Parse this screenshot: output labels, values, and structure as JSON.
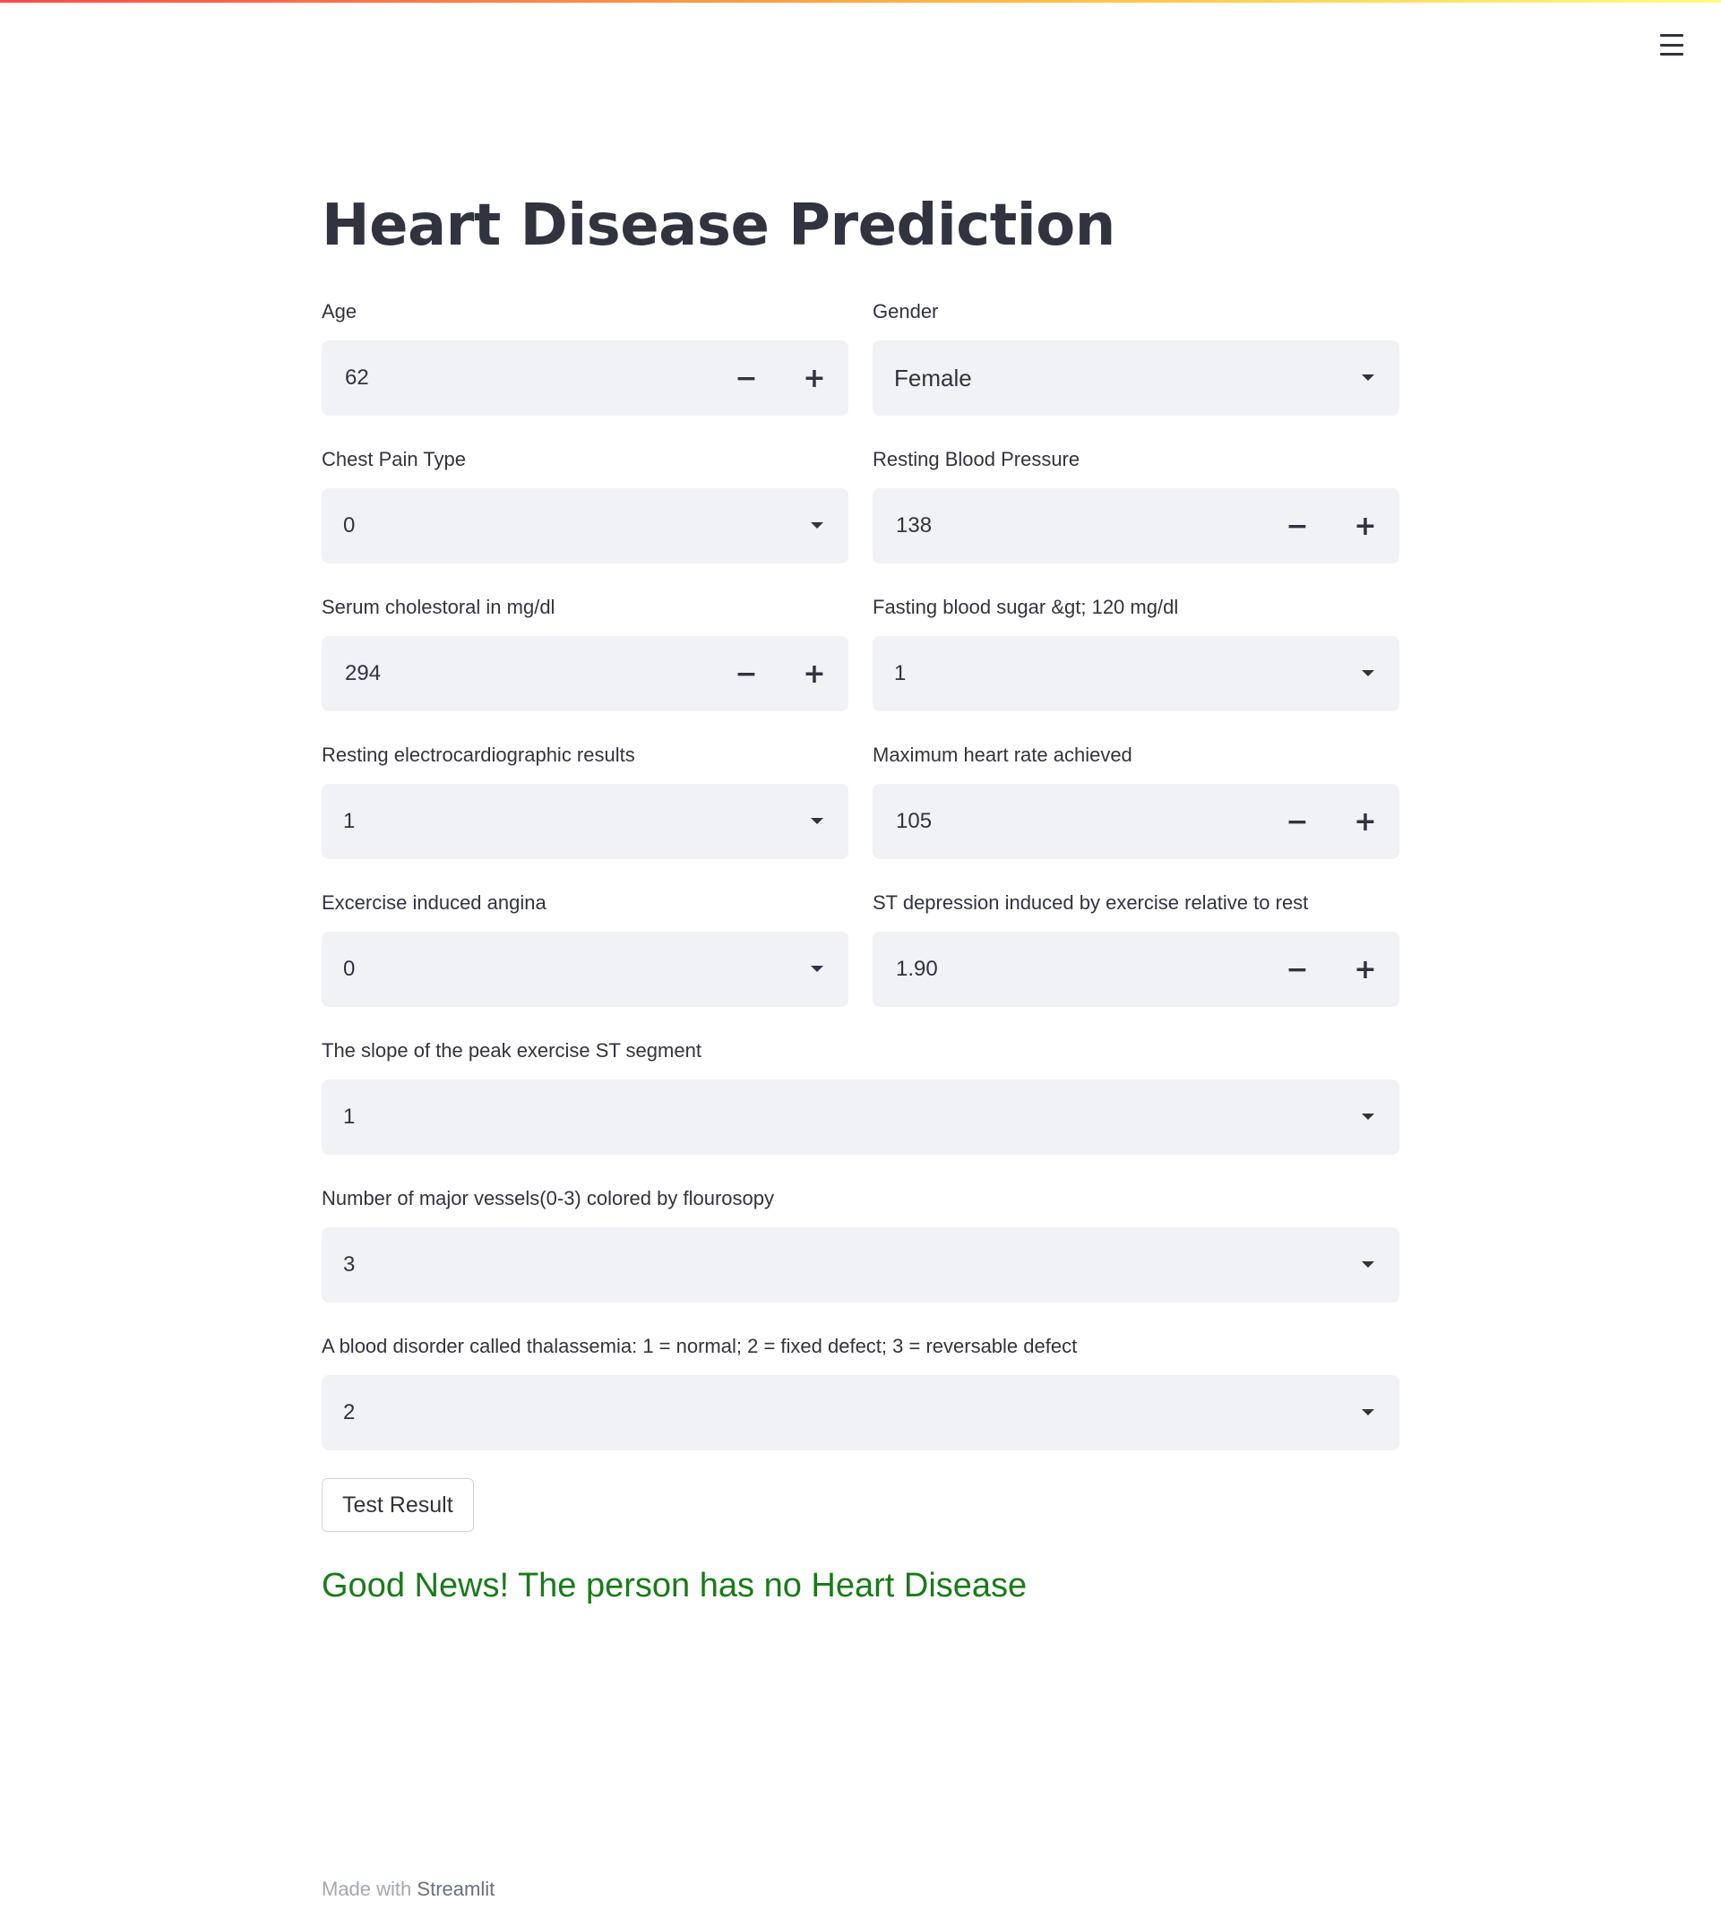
{
  "theme": {
    "accent_gradient": [
      "#ff4b4b",
      "#ffbd45",
      "#fffd80"
    ],
    "input_bg": "#f0f2f6",
    "text": "#31333f",
    "success": "#1a7a1a"
  },
  "header": {
    "menu_icon": "hamburger-icon"
  },
  "page": {
    "title": "Heart Disease Prediction"
  },
  "form": {
    "age": {
      "label": "Age",
      "value": "62",
      "minus": "−",
      "plus": "+"
    },
    "gender": {
      "label": "Gender",
      "value": "Female"
    },
    "chest_pain": {
      "label": "Chest Pain Type",
      "value": "0"
    },
    "resting_bp": {
      "label": "Resting Blood Pressure",
      "value": "138",
      "minus": "−",
      "plus": "+"
    },
    "cholesterol": {
      "label": "Serum cholestoral in mg/dl",
      "value": "294",
      "minus": "−",
      "plus": "+"
    },
    "fasting_sugar": {
      "label": "Fasting blood sugar &gt; 120 mg/dl",
      "value": "1"
    },
    "ecg": {
      "label": "Resting electrocardiographic results",
      "value": "1"
    },
    "max_hr": {
      "label": "Maximum heart rate achieved",
      "value": "105",
      "minus": "−",
      "plus": "+"
    },
    "angina": {
      "label": "Excercise induced angina",
      "value": "0"
    },
    "st_depression": {
      "label": "ST depression induced by exercise relative to rest",
      "value": "1.90",
      "minus": "−",
      "plus": "+"
    },
    "slope": {
      "label": "The slope of the peak exercise ST segment",
      "value": "1"
    },
    "vessels": {
      "label": "Number of major vessels(0-3) colored by flourosopy",
      "value": "3"
    },
    "thal": {
      "label": "A blood disorder called thalassemia: 1 = normal; 2 = fixed defect; 3 = reversable defect",
      "value": "2"
    }
  },
  "actions": {
    "submit_label": "Test Result"
  },
  "result": {
    "message": "Good News! The person has no Heart Disease"
  },
  "footer": {
    "prefix": "Made with",
    "brand": "Streamlit"
  }
}
